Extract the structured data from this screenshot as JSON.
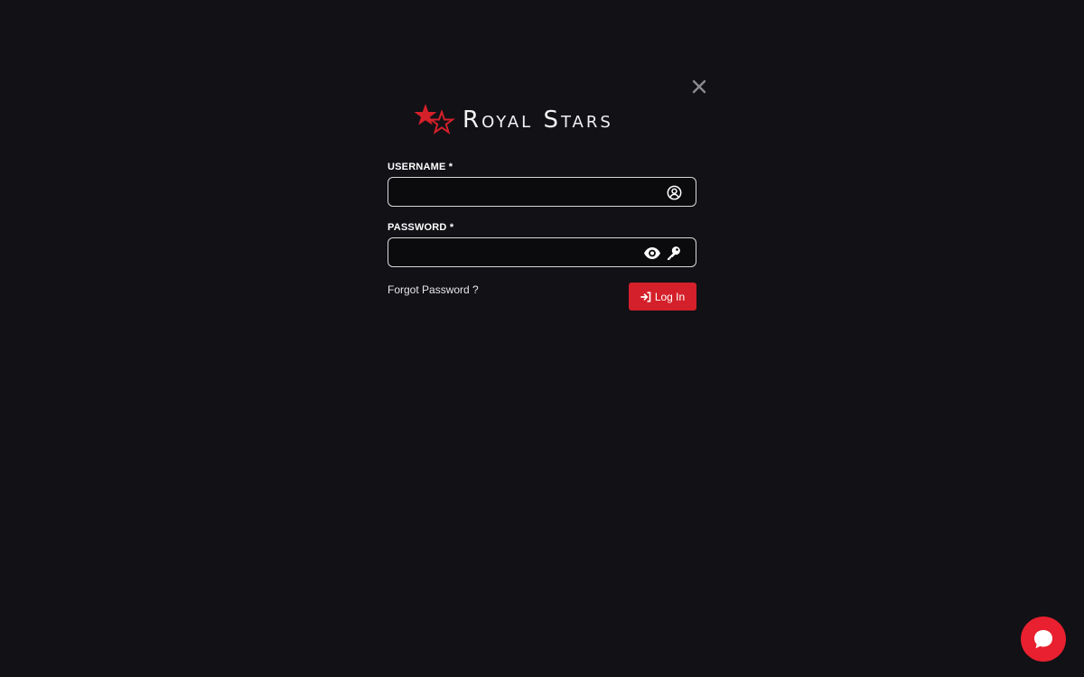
{
  "brand": {
    "name": "Royal Stars",
    "accent_color": "#d4202a",
    "logo_icon": "stars-logo-icon"
  },
  "close": {
    "icon": "close-icon"
  },
  "username": {
    "label": "USERNAME *",
    "value": "",
    "placeholder": "",
    "icon": "user-circle-icon"
  },
  "password": {
    "label": "PASSWORD *",
    "value": "",
    "placeholder": "",
    "icons": [
      "eye-icon",
      "key-icon"
    ]
  },
  "forgot": {
    "label": "Forgot Password ?"
  },
  "login": {
    "label": "Log In",
    "icon": "sign-in-icon"
  },
  "chat": {
    "icon": "chat-bubble-icon",
    "color": "#e8202f"
  }
}
